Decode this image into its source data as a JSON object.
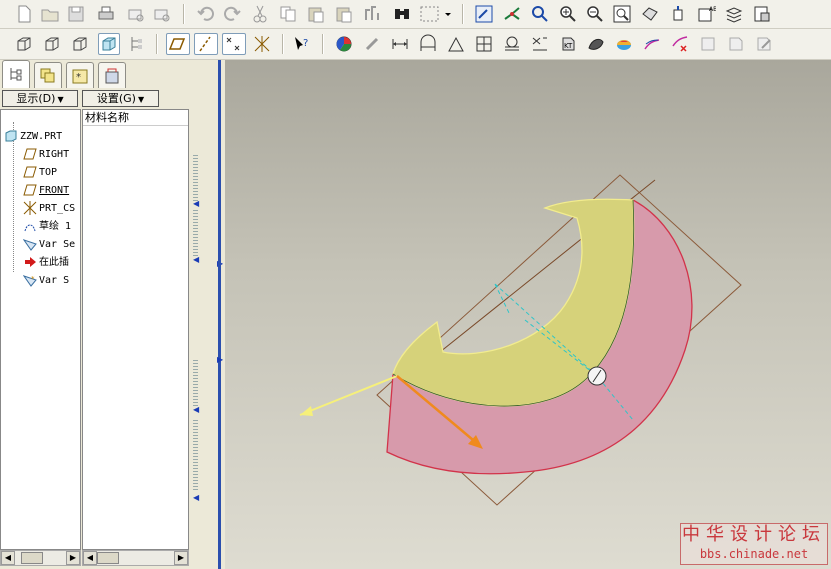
{
  "toolbar_top": {
    "icons": [
      "new-file-icon",
      "open-folder-icon",
      "save-icon",
      "print-icon",
      "send-mail-icon",
      "mail-attach-icon",
      "undo-icon",
      "redo-icon",
      "cut-icon",
      "copy-icon",
      "paste-icon",
      "paste-special-icon",
      "regenerate-icon",
      "find-icon",
      "selection-box-icon",
      "dropdown-icon",
      "repaint-icon",
      "spin-center-icon",
      "orient-mode-icon",
      "zoom-in-icon",
      "zoom-out-icon",
      "refit-icon",
      "reorient-icon",
      "saved-views-icon",
      "layers-icon",
      "view-manager-icon",
      "model-tree-settings-icon"
    ]
  },
  "toolbar_second": {
    "icons": [
      "wireframe-icon",
      "hidden-line-icon",
      "no-hidden-icon",
      "shading-icon",
      "model-tree-toggle-icon",
      "datum-planes-icon",
      "datum-axes-icon",
      "datum-points-icon",
      "csys-icon",
      "context-help-icon",
      "appearance-icon",
      "measure-icon",
      "dimension-icon",
      "section-icon",
      "angle-icon",
      "mass-props-icon",
      "clearance-icon",
      "reference-icon",
      "info-icon",
      "pattern-icon",
      "shaded-sphere-icon",
      "curvature-icon",
      "curve-analysis-icon",
      "draft-check-icon",
      "feature-info-icon",
      "edit-icon"
    ]
  },
  "left_panel": {
    "tabs": [
      "model-tree-tab",
      "layers-tab",
      "favorites-tab",
      "folder-tab"
    ],
    "show_menu": "显示(D)",
    "settings_menu": "设置(G)",
    "column_header": "材料名称",
    "tree_items": [
      {
        "label": "ZZW.PRT",
        "icon": "part-icon"
      },
      {
        "label": "RIGHT",
        "icon": "datum-plane-icon"
      },
      {
        "label": "TOP",
        "icon": "datum-plane-icon"
      },
      {
        "label": "FRONT",
        "icon": "datum-plane-icon"
      },
      {
        "label": "PRT_CS",
        "icon": "csys-icon"
      },
      {
        "label": "草绘 1",
        "icon": "sketch-icon"
      },
      {
        "label": "Var Se",
        "icon": "var-sec-sweep-icon"
      },
      {
        "label": "在此插",
        "icon": "insert-here-icon"
      },
      {
        "label": "Var S",
        "icon": "var-sec-sweep-icon"
      }
    ]
  },
  "watermark": {
    "title": "中华设计论坛",
    "url": "bbs.chinade.net"
  },
  "colors": {
    "viewport_top": "#a9a79c",
    "viewport_bottom": "#dedcd1",
    "surface_yellow": "#d6d27a",
    "surface_pink": "#d79aab",
    "edge_red": "#d2334a",
    "watermark_red": "#c9383d"
  }
}
